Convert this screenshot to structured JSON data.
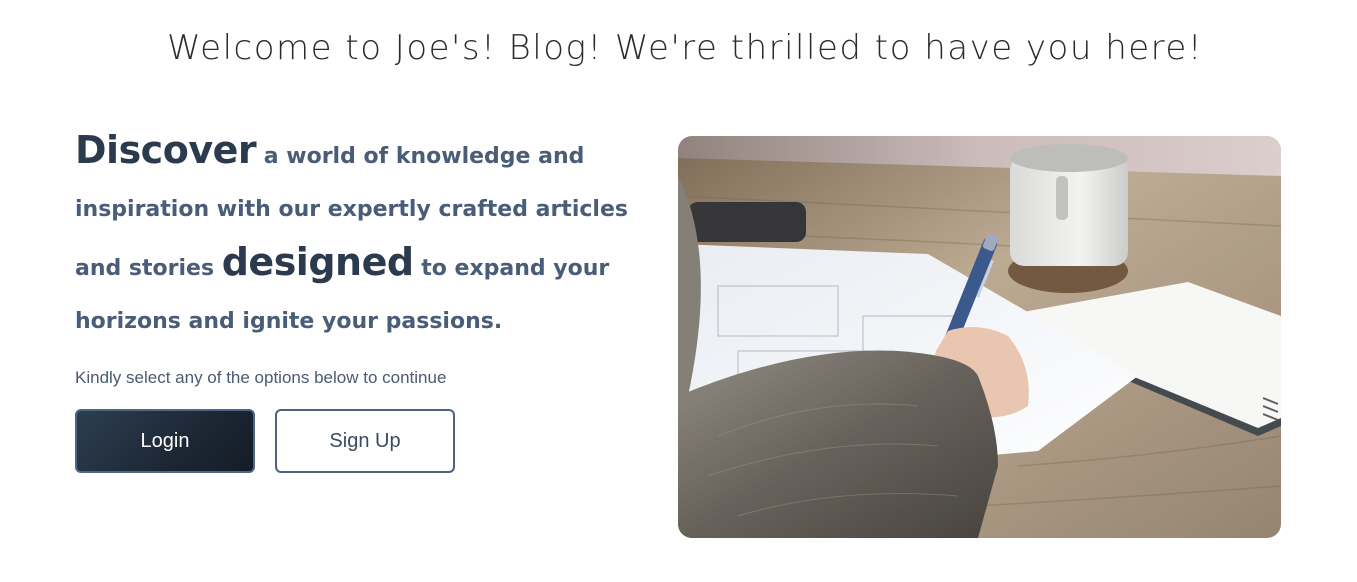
{
  "header": {
    "welcome": "Welcome to Joe's! Blog! We're thrilled to have you here!"
  },
  "intro": {
    "word_discover": "Discover",
    "text_1": " a world of knowledge and inspiration with our expertly crafted articles and stories ",
    "word_designed": "designed",
    "text_2": " to expand your horizons and ignite your passions."
  },
  "prompt": "Kindly select any of the options below to continue",
  "buttons": {
    "login": "Login",
    "signup": "Sign Up"
  },
  "colors": {
    "login_bg": "#1c2734",
    "accent_text": "#4a5d78"
  },
  "image": {
    "subject": "person-writing-with-pen-at-desk-photo"
  }
}
